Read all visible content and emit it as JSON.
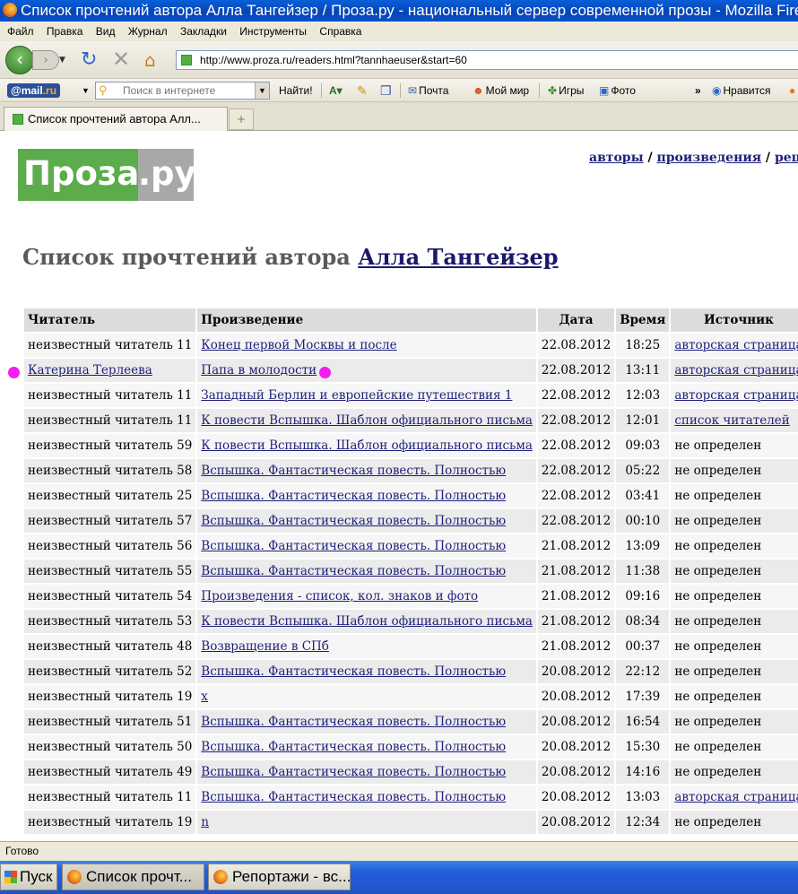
{
  "window": {
    "title": "Список прочтений автора Алла Тангейзер / Проза.ру - национальный сервер современной прозы - Mozilla Firefox"
  },
  "menu": [
    "Файл",
    "Правка",
    "Вид",
    "Журнал",
    "Закладки",
    "Инструменты",
    "Справка"
  ],
  "nav": {
    "url": "http://www.proza.ru/readers.html?tannhaeuser&start=60"
  },
  "mailru_toolbar": {
    "logo_prefix": "@",
    "logo_name": "mail",
    "logo_suffix": ".ru",
    "search_placeholder": "Поиск в интернете",
    "find_label": "Найти!",
    "mail_label": "Почта",
    "world_label": "Мой мир",
    "games_label": "Игры",
    "photo_label": "Фото",
    "more_label": "»",
    "like_label": "Нравится"
  },
  "tabs": {
    "active_label": "Список прочтений автора Алл...",
    "new_tab_label": "+"
  },
  "page": {
    "logo_left": "Проза",
    "logo_right": ".ру",
    "top_links": [
      "авторы",
      "произведения",
      "рецензии"
    ],
    "heading_prefix": "Список прочтений автора",
    "author_name": "Алла Тангейзер",
    "marker_color": "#f21ef0"
  },
  "table": {
    "headers": [
      "Читатель",
      "Произведение",
      "Дата",
      "Время",
      "Источник"
    ],
    "rows": [
      {
        "reader": "неизвестный читатель 11",
        "reader_link": false,
        "work": "Конец первой Москвы и после",
        "date": "22.08.2012",
        "time": "18:25",
        "source": "авторская страница",
        "source_link": true
      },
      {
        "reader": "Катерина Терлеева",
        "reader_link": true,
        "work": "Папа в молодости",
        "date": "22.08.2012",
        "time": "13:11",
        "source": "авторская страница",
        "source_link": true
      },
      {
        "reader": "неизвестный читатель 11",
        "reader_link": false,
        "work": "Западный Берлин и европейские путешествия 1",
        "date": "22.08.2012",
        "time": "12:03",
        "source": "авторская страница",
        "source_link": true
      },
      {
        "reader": "неизвестный читатель 11",
        "reader_link": false,
        "work": "К повести Вспышка. Шаблон официального письма",
        "date": "22.08.2012",
        "time": "12:01",
        "source": "список читателей",
        "source_link": true
      },
      {
        "reader": "неизвестный читатель 59",
        "reader_link": false,
        "work": "К повести Вспышка. Шаблон официального письма",
        "date": "22.08.2012",
        "time": "09:03",
        "source": "не определен",
        "source_link": false
      },
      {
        "reader": "неизвестный читатель 58",
        "reader_link": false,
        "work": "Вспышка. Фантастическая повесть. Полностью",
        "date": "22.08.2012",
        "time": "05:22",
        "source": "не определен",
        "source_link": false
      },
      {
        "reader": "неизвестный читатель 25",
        "reader_link": false,
        "work": "Вспышка. Фантастическая повесть. Полностью",
        "date": "22.08.2012",
        "time": "03:41",
        "source": "не определен",
        "source_link": false
      },
      {
        "reader": "неизвестный читатель 57",
        "reader_link": false,
        "work": "Вспышка. Фантастическая повесть. Полностью",
        "date": "22.08.2012",
        "time": "00:10",
        "source": "не определен",
        "source_link": false
      },
      {
        "reader": "неизвестный читатель 56",
        "reader_link": false,
        "work": "Вспышка. Фантастическая повесть. Полностью",
        "date": "21.08.2012",
        "time": "13:09",
        "source": "не определен",
        "source_link": false
      },
      {
        "reader": "неизвестный читатель 55",
        "reader_link": false,
        "work": "Вспышка. Фантастическая повесть. Полностью",
        "date": "21.08.2012",
        "time": "11:38",
        "source": "не определен",
        "source_link": false
      },
      {
        "reader": "неизвестный читатель 54",
        "reader_link": false,
        "work": "Произведения - список, кол. знаков и фото",
        "date": "21.08.2012",
        "time": "09:16",
        "source": "не определен",
        "source_link": false
      },
      {
        "reader": "неизвестный читатель 53",
        "reader_link": false,
        "work": "К повести Вспышка. Шаблон официального письма",
        "date": "21.08.2012",
        "time": "08:34",
        "source": "не определен",
        "source_link": false
      },
      {
        "reader": "неизвестный читатель 48",
        "reader_link": false,
        "work": "Возвращение в СПб",
        "date": "21.08.2012",
        "time": "00:37",
        "source": "не определен",
        "source_link": false
      },
      {
        "reader": "неизвестный читатель 52",
        "reader_link": false,
        "work": "Вспышка. Фантастическая повесть. Полностью",
        "date": "20.08.2012",
        "time": "22:12",
        "source": "не определен",
        "source_link": false
      },
      {
        "reader": "неизвестный читатель 19",
        "reader_link": false,
        "work": "x",
        "date": "20.08.2012",
        "time": "17:39",
        "source": "не определен",
        "source_link": false
      },
      {
        "reader": "неизвестный читатель 51",
        "reader_link": false,
        "work": "Вспышка. Фантастическая повесть. Полностью",
        "date": "20.08.2012",
        "time": "16:54",
        "source": "не определен",
        "source_link": false
      },
      {
        "reader": "неизвестный читатель 50",
        "reader_link": false,
        "work": "Вспышка. Фантастическая повесть. Полностью",
        "date": "20.08.2012",
        "time": "15:30",
        "source": "не определен",
        "source_link": false
      },
      {
        "reader": "неизвестный читатель 49",
        "reader_link": false,
        "work": "Вспышка. Фантастическая повесть. Полностью",
        "date": "20.08.2012",
        "time": "14:16",
        "source": "не определен",
        "source_link": false
      },
      {
        "reader": "неизвестный читатель 11",
        "reader_link": false,
        "work": "Вспышка. Фантастическая повесть. Полностью",
        "date": "20.08.2012",
        "time": "13:03",
        "source": "авторская страница",
        "source_link": true
      },
      {
        "reader": "неизвестный читатель 19",
        "reader_link": false,
        "work": "n",
        "date": "20.08.2012",
        "time": "12:34",
        "source": "не определен",
        "source_link": false
      }
    ]
  },
  "status": {
    "text": "Готово"
  },
  "taskbar": {
    "start_label": "Пуск",
    "tasks": [
      "Список прочт...",
      "Репортажи - вс..."
    ]
  }
}
